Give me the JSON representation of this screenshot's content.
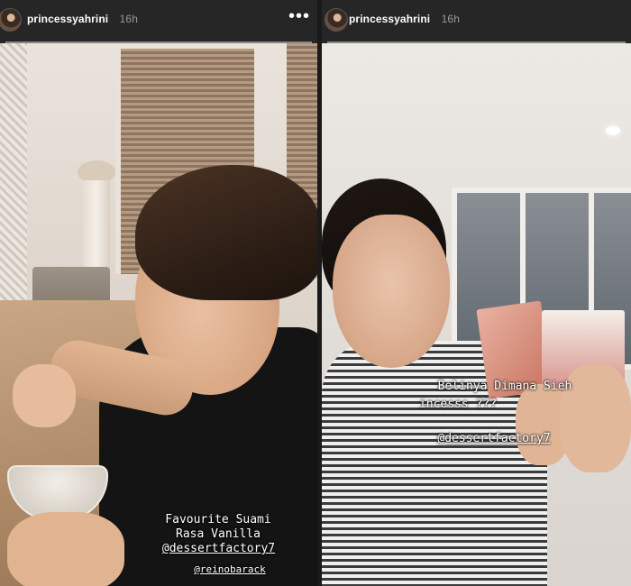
{
  "stories": [
    {
      "username": "princessyahrini",
      "time_ago": "16h",
      "more_icon": "more-horizontal-icon",
      "captions": [
        "Favourite Suami",
        "Rasa Vanilla",
        "@dessertfactory7",
        "@reinobarack"
      ]
    },
    {
      "username": "princessyahrini",
      "time_ago": "16h",
      "captions": [
        "Belinya Dimana Sieh",
        "incesss ???",
        "@dessertfactory7"
      ]
    }
  ],
  "colors": {
    "header_bg": "#262626",
    "caption_text": "#ffffff"
  }
}
